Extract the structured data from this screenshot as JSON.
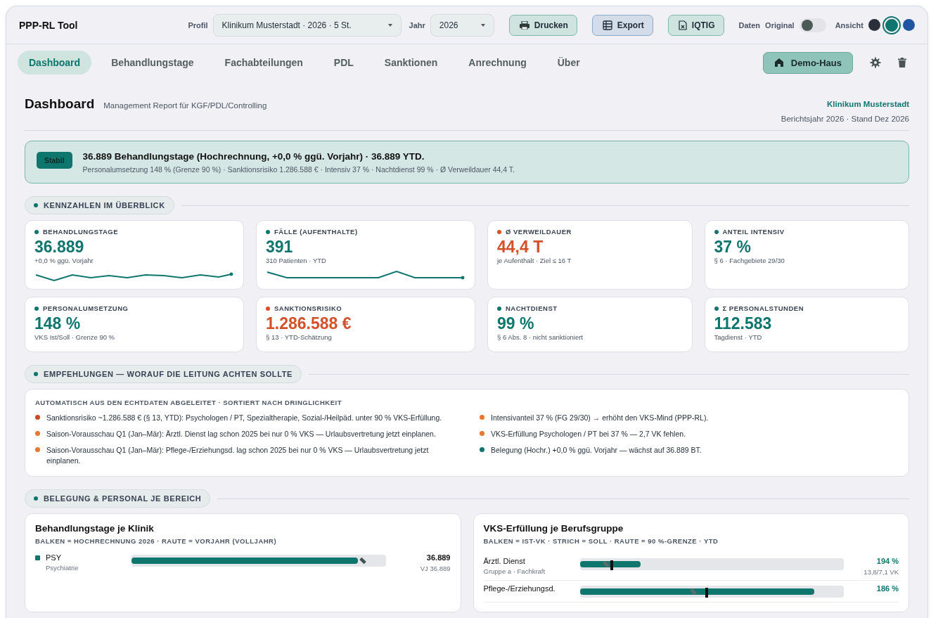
{
  "header": {
    "title": "PPP-RL Tool",
    "profile": {
      "label": "Profil",
      "value": "Klinikum Musterstadt · 2026 · 5 St."
    },
    "year": {
      "label": "Jahr",
      "value": "2026"
    },
    "buttons": [
      {
        "label": "Drucken",
        "kind": "print"
      },
      {
        "label": "Export",
        "kind": "table"
      },
      {
        "label": "IQTIG",
        "kind": "file"
      }
    ],
    "data_toggle": {
      "label": "Daten",
      "value_label": "Original",
      "on": false
    },
    "view": {
      "label": "Ansicht",
      "themes": [
        {
          "color": "#2b2f3a",
          "selected": false
        },
        {
          "color": "#0f766e",
          "selected": true
        },
        {
          "color": "#1f56a3",
          "selected": false
        }
      ]
    }
  },
  "tabs": [
    {
      "label": "Dashboard",
      "selected": true
    },
    {
      "label": "Behandlungstage",
      "selected": false
    },
    {
      "label": "Fachabteilungen",
      "selected": false
    },
    {
      "label": "PDL",
      "selected": false
    },
    {
      "label": "Sanktionen",
      "selected": false
    },
    {
      "label": "Anrechnung",
      "selected": false
    },
    {
      "label": "Über",
      "selected": false
    }
  ],
  "demo_button": {
    "label": "Demo-Haus"
  },
  "page": {
    "title": "Dashboard",
    "subtitle": "Management Report für KGF/PDL/Controlling",
    "org": "Klinikum Musterstadt",
    "report_info": "Berichtsjahr 2026 · Stand Dez 2026"
  },
  "banner": {
    "badge": "Stabil",
    "headline": "36.889 Behandlungstage (Hochrechnung, +0,0 % ggü. Vorjahr) · 36.889 YTD.",
    "details": "Personalumsetzung 148 % (Grenze 90 %) · Sanktionsrisiko 1.286.588 € · Intensiv 37 % · Nachtdienst 99 % · Ø Verweildauer 44,4 T."
  },
  "kpi_section": {
    "title": "KENNZAHLEN IM ÜBERBLICK"
  },
  "kpis": [
    {
      "label": "BEHANDLUNGSTAGE",
      "value": "36.889",
      "note": "+0,0 % ggü. Vorjahr",
      "color": "#0f766e",
      "kind": "trend"
    },
    {
      "label": "FÄLLE (AUFENTHALTE)",
      "value": "391",
      "note": "310 Patienten · YTD",
      "color": "#0f766e",
      "kind": "trend"
    },
    {
      "label": "Ø VERWEILDAUER",
      "value": "44,4 T",
      "note": "je Aufenthalt · Ziel ≤ 16 T",
      "color": "#d4522a",
      "kind": "plain"
    },
    {
      "label": "ANTEIL INTENSIV",
      "value": "37 %",
      "note": "§ 6 · Fachgebiete 29/30",
      "color": "#0f766e",
      "kind": "plain"
    },
    {
      "label": "PERSONALUMSETZUNG",
      "value": "148 %",
      "note": "VKS Ist/Soll · Grenze 90 %",
      "color": "#0f766e",
      "kind": "plain"
    },
    {
      "label": "SANKTIONSRISIKO",
      "value": "1.286.588 €",
      "note": "§ 13 · YTD-Schätzung",
      "color": "#d4522a",
      "kind": "plain"
    },
    {
      "label": "NACHTDIENST",
      "value": "99 %",
      "note": "§ 6 Abs. 8 · nicht sanktioniert",
      "color": "#0f766e",
      "kind": "plain"
    },
    {
      "label": "Σ PERSONALSTUNDEN",
      "value": "112.583",
      "note": "Tagdienst · YTD",
      "color": "#0f766e",
      "kind": "plain"
    }
  ],
  "recommendations": {
    "section_title": "EMPFEHLUNGEN — WORAUF DIE LEITUNG ACHTEN SOLLTE",
    "heading": "AUTOMATISCH AUS DEN ECHTDATEN ABGELEITET · SORTIERT NACH DRINGLICHKEIT",
    "items": [
      {
        "text": "Sanktionsrisiko ~1.286.588 € (§ 13, YTD): Psychologen / PT, Spezialtherapie, Sozial-/Heilpäd. unter 90 % VKS-Erfüllung.",
        "color": "#cc4a28"
      },
      {
        "text": "Saison-Vorausschau Q1 (Jan–Mär): Ärztl. Dienst lag schon 2025 bei nur 0 % VKS — Urlaubsvertretung jetzt einplanen.",
        "color": "#e6792f"
      },
      {
        "text": "Saison-Vorausschau Q1 (Jan–Mär): Pflege-/Erziehungsd. lag schon 2025 bei nur 0 % VKS — Urlaubsvertretung jetzt einplanen.",
        "color": "#e6792f"
      },
      {
        "text": "Intensivanteil 37 % (FG 29/30) → erhöht den VKS-Mind (PPP-RL).",
        "color": "#e6792f"
      },
      {
        "text": "VKS-Erfüllung Psychologen / PT bei 37 % — 2,7 VK fehlen.",
        "color": "#e6792f"
      },
      {
        "text": "Belegung (Hochr.) +0,0 % ggü. Vorjahr — wächst auf 36.889 BT.",
        "color": "#0f766e"
      }
    ]
  },
  "area_section": {
    "title": "BELEGUNG & PERSONAL JE BEREICH"
  },
  "clinic_card": {
    "title": "Behandlungstage je Klinik",
    "legend": "BALKEN = HOCHRECHNUNG 2026 · RAUTE = VORJAHR (VOLLJAHR)",
    "rows": [
      {
        "code": "PSY",
        "name": "Psychiatrie",
        "value": "36.889",
        "prev": "VJ 36.889",
        "color": "#0f766e",
        "level": 0.89,
        "prev_mark": {
          "level": 0.91
        }
      }
    ]
  },
  "staff_card": {
    "title": "VKS-Erfüllung je Berufsgruppe",
    "legend": "BALKEN = IST-VK · STRICH = SOLL · RAUTE = 90 %-GRENZE · YTD",
    "rows": [
      {
        "name": "Ärztl. Dienst",
        "note": "Gruppe a · Fachkraft",
        "pct": "194 %",
        "detail": "13,8/7,1 VK",
        "level": 0.23,
        "target": {
          "level": 0.12
        },
        "threshold": {
          "level": 0.1
        }
      },
      {
        "name": "Pflege-/Erziehungsd.",
        "pct": "186 %",
        "level": 0.89,
        "target": {
          "level": 0.48
        },
        "threshold": {
          "level": 0.43
        }
      }
    ]
  }
}
